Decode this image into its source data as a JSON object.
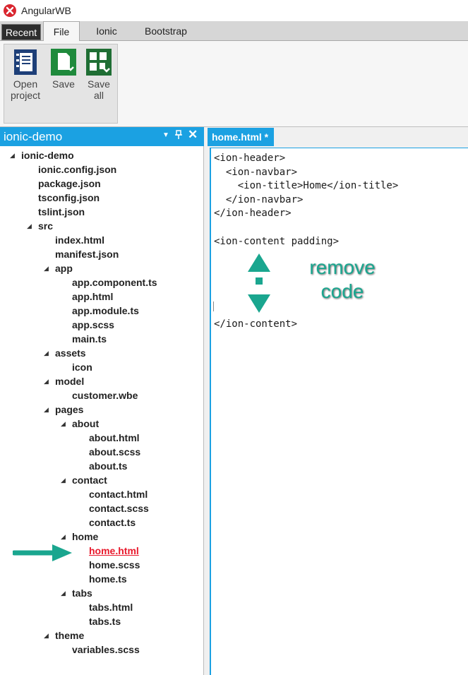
{
  "window": {
    "title": "AngularWB"
  },
  "ribbon": {
    "tabs": [
      "Recent",
      "File",
      "Ionic",
      "Bootstrap"
    ],
    "buttons": [
      {
        "label_line1": "Open",
        "label_line2": "project",
        "icon": "notebook-icon"
      },
      {
        "label_line1": "Save",
        "label_line2": "",
        "icon": "save-file-icon"
      },
      {
        "label_line1": "Save",
        "label_line2": "all",
        "icon": "save-all-icon"
      }
    ]
  },
  "explorer": {
    "title": "ionic-demo",
    "controls": {
      "dropdown": "▾",
      "pin": "ᵖ",
      "close": "✕"
    },
    "tree": [
      {
        "label": "ionic-demo",
        "depth": 0,
        "expanded": true
      },
      {
        "label": "ionic.config.json",
        "depth": 1
      },
      {
        "label": "package.json",
        "depth": 1
      },
      {
        "label": "tsconfig.json",
        "depth": 1
      },
      {
        "label": "tslint.json",
        "depth": 1
      },
      {
        "label": "src",
        "depth": 1,
        "expanded": true
      },
      {
        "label": "index.html",
        "depth": 2
      },
      {
        "label": "manifest.json",
        "depth": 2
      },
      {
        "label": "app",
        "depth": 2,
        "expanded": true
      },
      {
        "label": "app.component.ts",
        "depth": 3
      },
      {
        "label": "app.html",
        "depth": 3
      },
      {
        "label": "app.module.ts",
        "depth": 3
      },
      {
        "label": "app.scss",
        "depth": 3
      },
      {
        "label": "main.ts",
        "depth": 3
      },
      {
        "label": "assets",
        "depth": 2,
        "expanded": true
      },
      {
        "label": "icon",
        "depth": 3
      },
      {
        "label": "model",
        "depth": 2,
        "expanded": true
      },
      {
        "label": "customer.wbe",
        "depth": 3
      },
      {
        "label": "pages",
        "depth": 2,
        "expanded": true
      },
      {
        "label": "about",
        "depth": 3,
        "expanded": true
      },
      {
        "label": "about.html",
        "depth": 4
      },
      {
        "label": "about.scss",
        "depth": 4
      },
      {
        "label": "about.ts",
        "depth": 4
      },
      {
        "label": "contact",
        "depth": 3,
        "expanded": true
      },
      {
        "label": "contact.html",
        "depth": 4
      },
      {
        "label": "contact.scss",
        "depth": 4
      },
      {
        "label": "contact.ts",
        "depth": 4
      },
      {
        "label": "home",
        "depth": 3,
        "expanded": true
      },
      {
        "label": "home.html",
        "depth": 4,
        "selected": true
      },
      {
        "label": "home.scss",
        "depth": 4
      },
      {
        "label": "home.ts",
        "depth": 4
      },
      {
        "label": "tabs",
        "depth": 3,
        "expanded": true
      },
      {
        "label": "tabs.html",
        "depth": 4
      },
      {
        "label": "tabs.ts",
        "depth": 4
      },
      {
        "label": "theme",
        "depth": 2,
        "expanded": true
      },
      {
        "label": "variables.scss",
        "depth": 3
      }
    ]
  },
  "editor": {
    "tab_label": "home.html *",
    "lines": [
      "<ion-header>",
      "  <ion-navbar>",
      "    <ion-title>Home</ion-title>",
      "  </ion-navbar>",
      "</ion-header>",
      "",
      "<ion-content padding>",
      "",
      "",
      "",
      "",
      "",
      "</ion-content>"
    ],
    "annotation_line1": "remove",
    "annotation_line2": "code"
  },
  "colors": {
    "accent": "#1ba1e2",
    "selected": "#e8192c",
    "annotation": "#1aa68f"
  }
}
